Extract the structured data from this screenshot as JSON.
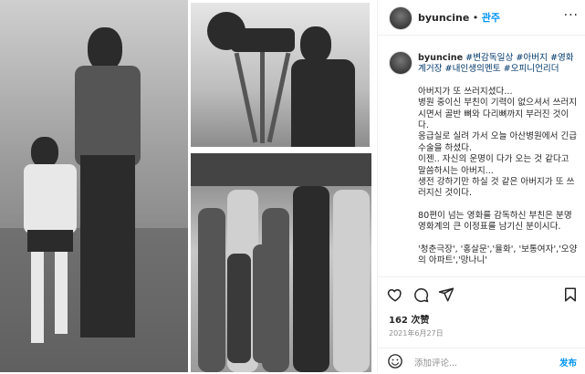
{
  "header": {
    "username": "byuncine",
    "separator": " • ",
    "follow_label": "관주",
    "more_label": "···"
  },
  "caption": {
    "username": "byuncine",
    "hashtags": "#변감독일상 #아버지 #영화계거장 #내인생의멘토 #오피니언리더",
    "paragraphs": [
      "아버지가 또 쓰러지셨다...\n병원 중이신 부친이 기력이 없으셔서 쓰러지시면서 골반 뼈와 다리뼈까지 부러진 것이다.\n응급실로 실려 가서 오늘 아산병원에서 긴급수술을 하셨다.\n이젠.. 자신의 운명이 다가 오는 것 같다고 말씀하시는 아버지...\n생전 강하기만 하실 것 같은 아버지가 또 쓰러지신 것이다.",
      "80편이 넘는 영화를 감독하신 부친은 분명 영화계의 큰 이정표를 남기신 분이시다.",
      "'청춘극장', '홍살문','율화', '보통여자','오양의 아파트','망나니'"
    ]
  },
  "actions": {
    "likes": "162 次赞",
    "date": "2021年6月27日"
  },
  "comment": {
    "placeholder": "添加评论...",
    "post_label": "发布"
  },
  "icons": {
    "like": "heart-icon",
    "comment": "comment-icon",
    "share": "send-icon",
    "save": "bookmark-icon",
    "emoji": "smiley-icon"
  }
}
